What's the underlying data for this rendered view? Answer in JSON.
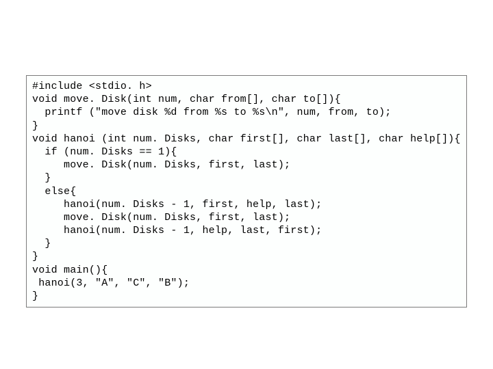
{
  "code": {
    "lines": [
      "#include <stdio. h>",
      "void move. Disk(int num, char from[], char to[]){",
      "  printf (\"move disk %d from %s to %s\\n\", num, from, to);",
      "}",
      "void hanoi (int num. Disks, char first[], char last[], char help[]){",
      "  if (num. Disks == 1){",
      "     move. Disk(num. Disks, first, last);",
      "  }",
      "  else{",
      "     hanoi(num. Disks - 1, first, help, last);",
      "     move. Disk(num. Disks, first, last);",
      "     hanoi(num. Disks - 1, help, last, first);",
      "  }",
      "}",
      "void main(){",
      " hanoi(3, \"A\", \"C\", \"B\");",
      "}"
    ]
  }
}
